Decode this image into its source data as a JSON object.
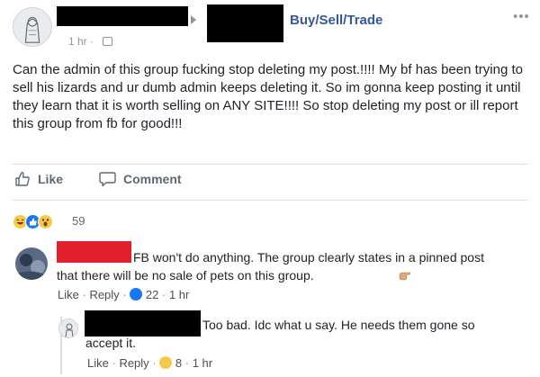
{
  "header": {
    "group_name": "Buy/Sell/Trade",
    "timestamp": "1 hr",
    "separator": "·"
  },
  "post": {
    "text": "Can the admin of this group fucking stop deleting my post.!!!! My bf has been trying to sell his lizards and ur dumb admin keeps deleting it. So im gonna keep posting it until they learn that it is worth selling on ANY SITE!!!! So stop deleting my post or ill report this group from fb for good!!!"
  },
  "actions": {
    "like_label": "Like",
    "comment_label": "Comment"
  },
  "reactions": {
    "count": "59",
    "icons": [
      "haha-icon",
      "like-icon",
      "wow-icon"
    ]
  },
  "comments": [
    {
      "text": "FB won't do anything. The group clearly states in a pinned post that there will be no sale of pets on this group.",
      "like_label": "Like",
      "reply_label": "Reply",
      "reaction_count": "22",
      "timestamp": "1 hr"
    },
    {
      "text": "Too bad. Idc what u say. He needs them gone so accept it.",
      "like_label": "Like",
      "reply_label": "Reply",
      "reaction_count": "8",
      "timestamp": "1 hr"
    }
  ],
  "colors": {
    "link": "#365899",
    "meta": "#90949c",
    "like_blue": "#1877f2"
  }
}
